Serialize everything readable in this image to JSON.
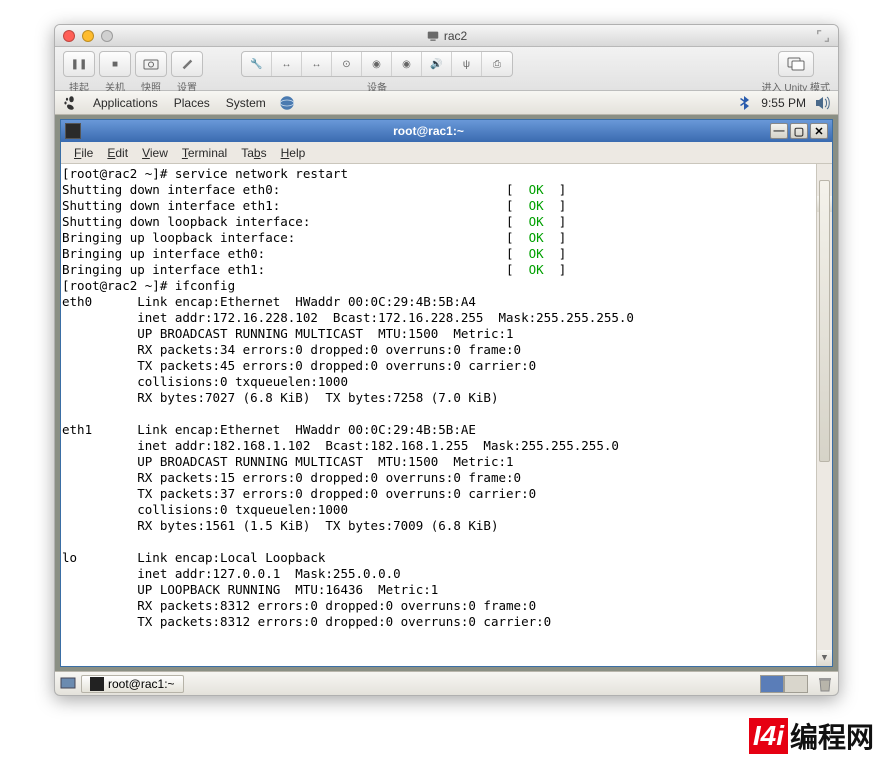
{
  "host": {
    "window_title": "rac2",
    "toolbar_labels": {
      "suspend": "挂起",
      "shutdown": "关机",
      "snapshot": "快照",
      "settings": "设置",
      "devices": "设备",
      "unity": "进入 Unity 模式"
    }
  },
  "gnome": {
    "menus": {
      "applications": "Applications",
      "places": "Places",
      "system": "System"
    },
    "time": "9:55 PM"
  },
  "terminal": {
    "title": "root@rac1:~",
    "menu": {
      "file": "File",
      "edit": "Edit",
      "view": "View",
      "terminal": "Terminal",
      "tabs": "Tabs",
      "help": "Help"
    },
    "prompt1": "[root@rac2 ~]# ",
    "cmd1": "service network restart",
    "prompt2": "[root@rac2 ~]# ",
    "cmd2": "ifconfig",
    "status_lines": [
      {
        "text": "Shutting down interface eth0:",
        "status": "OK"
      },
      {
        "text": "Shutting down interface eth1:",
        "status": "OK"
      },
      {
        "text": "Shutting down loopback interface:",
        "status": "OK"
      },
      {
        "text": "Bringing up loopback interface:",
        "status": "OK"
      },
      {
        "text": "Bringing up interface eth0:",
        "status": "OK"
      },
      {
        "text": "Bringing up interface eth1:",
        "status": "OK"
      }
    ],
    "ifconfig": {
      "eth0": [
        "Link encap:Ethernet  HWaddr 00:0C:29:4B:5B:A4",
        "inet addr:172.16.228.102  Bcast:172.16.228.255  Mask:255.255.255.0",
        "UP BROADCAST RUNNING MULTICAST  MTU:1500  Metric:1",
        "RX packets:34 errors:0 dropped:0 overruns:0 frame:0",
        "TX packets:45 errors:0 dropped:0 overruns:0 carrier:0",
        "collisions:0 txqueuelen:1000",
        "RX bytes:7027 (6.8 KiB)  TX bytes:7258 (7.0 KiB)"
      ],
      "eth1": [
        "Link encap:Ethernet  HWaddr 00:0C:29:4B:5B:AE",
        "inet addr:182.168.1.102  Bcast:182.168.1.255  Mask:255.255.255.0",
        "UP BROADCAST RUNNING MULTICAST  MTU:1500  Metric:1",
        "RX packets:15 errors:0 dropped:0 overruns:0 frame:0",
        "TX packets:37 errors:0 dropped:0 overruns:0 carrier:0",
        "collisions:0 txqueuelen:1000",
        "RX bytes:1561 (1.5 KiB)  TX bytes:7009 (6.8 KiB)"
      ],
      "lo": [
        "Link encap:Local Loopback",
        "inet addr:127.0.0.1  Mask:255.0.0.0",
        "UP LOOPBACK RUNNING  MTU:16436  Metric:1",
        "RX packets:8312 errors:0 dropped:0 overruns:0 frame:0",
        "TX packets:8312 errors:0 dropped:0 overruns:0 carrier:0"
      ]
    }
  },
  "taskbar": {
    "task1": "root@rac1:~"
  },
  "watermark": {
    "logo": "I4i",
    "text": "编程网"
  }
}
